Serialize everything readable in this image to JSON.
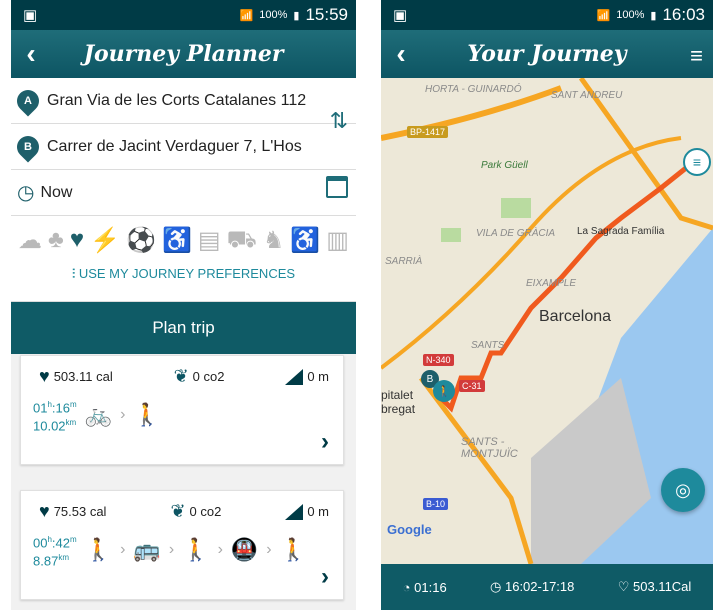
{
  "phone1": {
    "status": {
      "time": "15:59",
      "battery": "100%"
    },
    "title": "Journey Planner",
    "origin": {
      "badge": "A",
      "value": "Gran Via de les Corts Catalanes 112"
    },
    "destination": {
      "badge": "B",
      "value": "Carrer de Jacint Verdaguer 7, L'Hos"
    },
    "when": {
      "value": "Now"
    },
    "preferences_link": "USE MY JOURNEY PREFERENCES",
    "plan_button": "Plan trip",
    "results": [
      {
        "calories": "503.11 cal",
        "co2": "0 co2",
        "elevation": "0 m",
        "hours": "01",
        "minutes": "16",
        "distance": "10.02",
        "distance_unit": "km",
        "legs": [
          "bike-share-icon",
          "walk-icon"
        ]
      },
      {
        "calories": "75.53 cal",
        "co2": "0 co2",
        "elevation": "0 m",
        "hours": "00",
        "minutes": "42",
        "distance": "8.87",
        "distance_unit": "km",
        "legs": [
          "walk-icon",
          "bus-icon",
          "walk-icon",
          "metro-icon",
          "walk-icon"
        ]
      }
    ]
  },
  "phone2": {
    "status": {
      "time": "16:03",
      "battery": "100%"
    },
    "title": "Your Journey",
    "map_labels": {
      "horta": "HORTA -\nGUINARDÓ",
      "sant_andreu": "SANT ANDREU",
      "park_guell": "Park Güell",
      "vila_gracia": "VILA DE GRÀCIA",
      "sagrada": "La Sagrada Família",
      "sarria": "SARRIÀ",
      "eixample": "EIXAMPLE",
      "barcelona": "Barcelona",
      "sants": "SANTS",
      "hospitalet": "pitalet\nbregat",
      "sants_montjuic": "SANTS -\nMONTJUÏC",
      "google": "Google",
      "road_bp": "BP-1417",
      "road_n340": "N-340",
      "road_c31": "C-31",
      "road_b10": "B-10"
    },
    "summary": {
      "duration": "01:16",
      "time_range": "16:02-17:18",
      "calories": "503.11Cal"
    }
  },
  "colors": {
    "primary": "#0f5b66",
    "accent": "#1e8a9c",
    "route": "#f05a1e"
  }
}
